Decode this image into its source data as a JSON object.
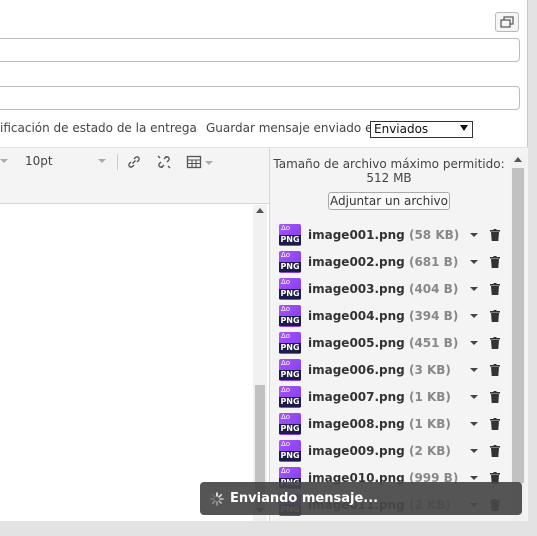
{
  "window": {
    "restore_icon": "restore-window-icon"
  },
  "options": {
    "delivery_status": "ificación de estado de la entrega",
    "save_sent_label": "Guardar mensaje enviado en",
    "save_sent_value": "Enviados"
  },
  "toolbar": {
    "font_size": "10pt",
    "icons": [
      "link-icon",
      "unlink-icon",
      "table-icon"
    ]
  },
  "attachments": {
    "max_size_line1": "Tamaño de archivo máximo permitido:",
    "max_size_line2": "512 MB",
    "add_button": "Adjuntar un archivo",
    "files": [
      {
        "name": "image001.png",
        "size": "(58 KB)"
      },
      {
        "name": "image002.png",
        "size": "(681 B)"
      },
      {
        "name": "image003.png",
        "size": "(404 B)"
      },
      {
        "name": "image004.png",
        "size": "(394 B)"
      },
      {
        "name": "image005.png",
        "size": "(451 B)"
      },
      {
        "name": "image006.png",
        "size": "(3 KB)"
      },
      {
        "name": "image007.png",
        "size": "(1 KB)"
      },
      {
        "name": "image008.png",
        "size": "(1 KB)"
      },
      {
        "name": "image009.png",
        "size": "(2 KB)"
      },
      {
        "name": "image010.png",
        "size": "(999 B)"
      },
      {
        "name": "image011.png",
        "size": "(2 KB)"
      }
    ],
    "file_type_label": "PNG"
  },
  "toast": {
    "text": "Enviando mensaje..."
  },
  "colors": {
    "png_icon": "#8b5cf6",
    "toast_bg": "#464646"
  }
}
